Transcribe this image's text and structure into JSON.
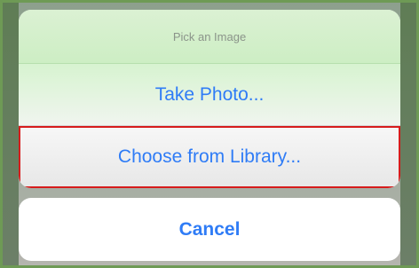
{
  "sheet": {
    "title": "Pick an Image",
    "actions": [
      {
        "label": "Take Photo..."
      },
      {
        "label": "Choose from Library..."
      }
    ],
    "cancel_label": "Cancel"
  },
  "colors": {
    "accent": "#2f7cf6",
    "highlight": "#d61c1c"
  }
}
